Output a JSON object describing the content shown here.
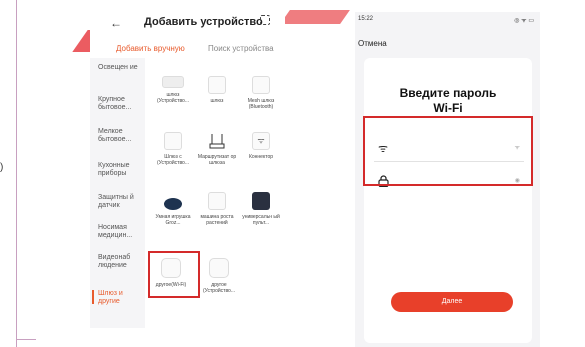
{
  "left_screen": {
    "back_icon": "arrow-left-icon",
    "title": "Добавить устройство",
    "scan_icon": "scan-icon",
    "tabs": [
      {
        "label": "Добавить вручную",
        "active": true
      },
      {
        "label": "Поиск устройства",
        "active": false
      }
    ],
    "categories": [
      {
        "label": "Освещен ие",
        "active": false
      },
      {
        "label": "Крупное бытовое...",
        "active": false
      },
      {
        "label": "Мелкое бытовое...",
        "active": false
      },
      {
        "label": "Кухонные приборы",
        "active": false
      },
      {
        "label": "Защитны й датчик",
        "active": false
      },
      {
        "label": "Носимая медицин...",
        "active": false
      },
      {
        "label": "Видеонаб людение",
        "active": false
      },
      {
        "label": "Шлюз и другие",
        "active": true
      }
    ],
    "devices": [
      {
        "label": "шлюз (Устройство...",
        "icon": "gateway-box-icon"
      },
      {
        "label": "шлюз",
        "icon": "gateway-icon"
      },
      {
        "label": "Mesh шлюз (Bluetooth)",
        "icon": "mesh-gateway-icon"
      },
      {
        "label": "Шлюз с (Устройство...",
        "icon": "gateway-plug-icon"
      },
      {
        "label": "Маршрутизат ор шлюза",
        "icon": "router-icon"
      },
      {
        "label": "Коннектор",
        "icon": "connector-icon"
      },
      {
        "label": "Умная игрушка Groz...",
        "icon": "robot-toy-icon"
      },
      {
        "label": "машина роста растений",
        "icon": "plant-grower-icon"
      },
      {
        "label": "универсальн ый пульт...",
        "icon": "remote-icon"
      },
      {
        "label": "другое(Wi-Fi)",
        "icon": "wifi-device-icon"
      },
      {
        "label": "другое (Устройство...",
        "icon": "other-device-icon"
      }
    ]
  },
  "right_screen": {
    "status_time": "15:22",
    "status_icons": "◎ ᯤ ▭",
    "cancel_label": "Отмена",
    "title_line1": "Введите пароль",
    "title_line2": "Wi-Fi",
    "wifi_field": {
      "icon": "wifi-icon",
      "trailing": "ᯤ"
    },
    "password_field": {
      "icon": "lock-icon",
      "trailing": "◉"
    },
    "next_label": "Далее"
  },
  "outer": {
    "paren": ")"
  },
  "colors": {
    "accent": "#e85b2d",
    "highlight": "#d42a2a",
    "button": "#e8402a"
  }
}
